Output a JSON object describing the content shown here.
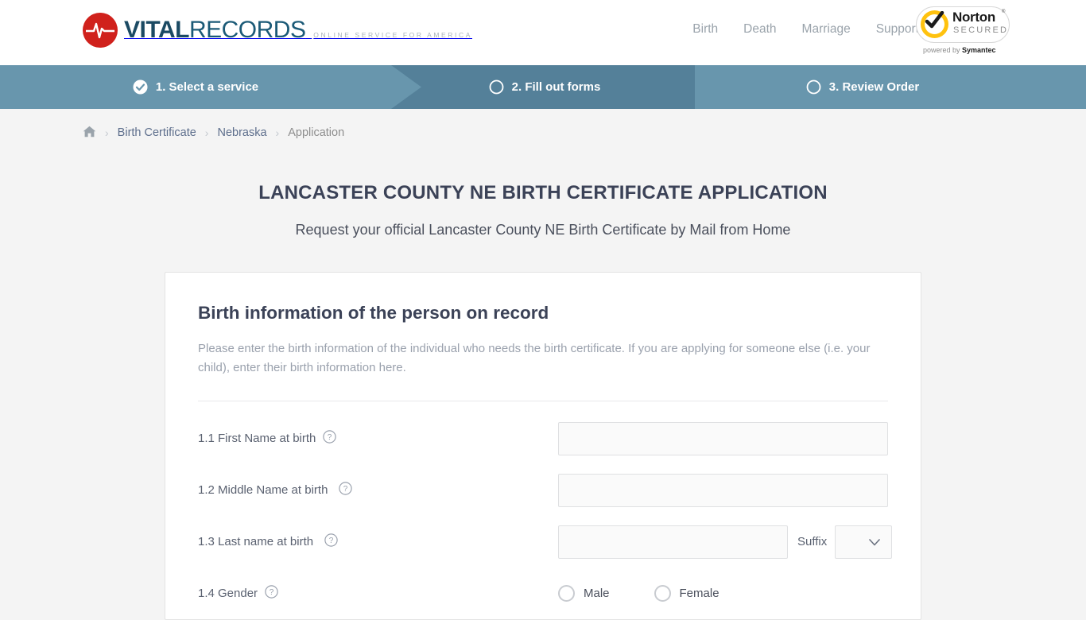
{
  "header": {
    "logo": {
      "mark": "heartbeat-circle-icon",
      "title_bold": "VITAL",
      "title_light": "RECORDS",
      "tagline": "ONLINE SERVICE FOR AMERICA"
    },
    "nav": [
      {
        "label": "Birth"
      },
      {
        "label": "Death"
      },
      {
        "label": "Marriage"
      },
      {
        "label": "Support"
      }
    ],
    "trust_badge": {
      "brand": "Norton",
      "trademark": "®",
      "status": "SECURED",
      "powered_prefix": "powered by ",
      "powered_brand": "Symantec",
      "check_icon": "checkmark-icon"
    }
  },
  "steps": [
    {
      "label": "1. Select a service",
      "icon": "check-circle-filled-icon",
      "state": "completed"
    },
    {
      "label": "2. Fill out forms",
      "icon": "circle-outline-icon",
      "state": "active"
    },
    {
      "label": "3. Review Order",
      "icon": "circle-outline-icon",
      "state": "upcoming"
    }
  ],
  "breadcrumb": {
    "home_icon": "home-icon",
    "separator": "›",
    "items": [
      {
        "label": "Birth Certificate",
        "current": false
      },
      {
        "label": "Nebraska",
        "current": false
      },
      {
        "label": "Application",
        "current": true
      }
    ]
  },
  "page": {
    "title": "LANCASTER COUNTY NE BIRTH CERTIFICATE APPLICATION",
    "subtitle": "Request your official Lancaster County NE Birth Certificate by Mail from Home"
  },
  "form": {
    "section_title": "Birth information of the person on record",
    "section_description": "Please enter the birth information of the individual who needs the birth certificate. If you are applying for someone else (i.e. your child), enter their birth information here.",
    "fields": {
      "first_name": {
        "label": "1.1 First Name at birth",
        "value": "",
        "placeholder": "",
        "help_icon": "question-circle-icon"
      },
      "middle_name": {
        "label": "1.2 Middle Name at birth",
        "value": "",
        "placeholder": "",
        "help_icon": "question-circle-icon"
      },
      "last_name": {
        "label": "1.3 Last name at birth",
        "value": "",
        "placeholder": "",
        "help_icon": "question-circle-icon"
      },
      "suffix": {
        "label": "Suffix",
        "value": "",
        "chevron_icon": "chevron-down-icon"
      },
      "gender": {
        "label": "1.4 Gender",
        "help_icon": "question-circle-icon",
        "options": [
          {
            "label": "Male",
            "selected": false
          },
          {
            "label": "Female",
            "selected": false
          }
        ]
      }
    }
  },
  "colors": {
    "page_bg": "#f4f4f4",
    "step_bar": "#6896ad",
    "step_active": "#548099",
    "heading": "#3b4257",
    "muted_text": "#9aa1ad",
    "logo_red": "#d0211c",
    "logo_blue": "#1b4a63",
    "norton_yellow": "#ffc20e"
  }
}
